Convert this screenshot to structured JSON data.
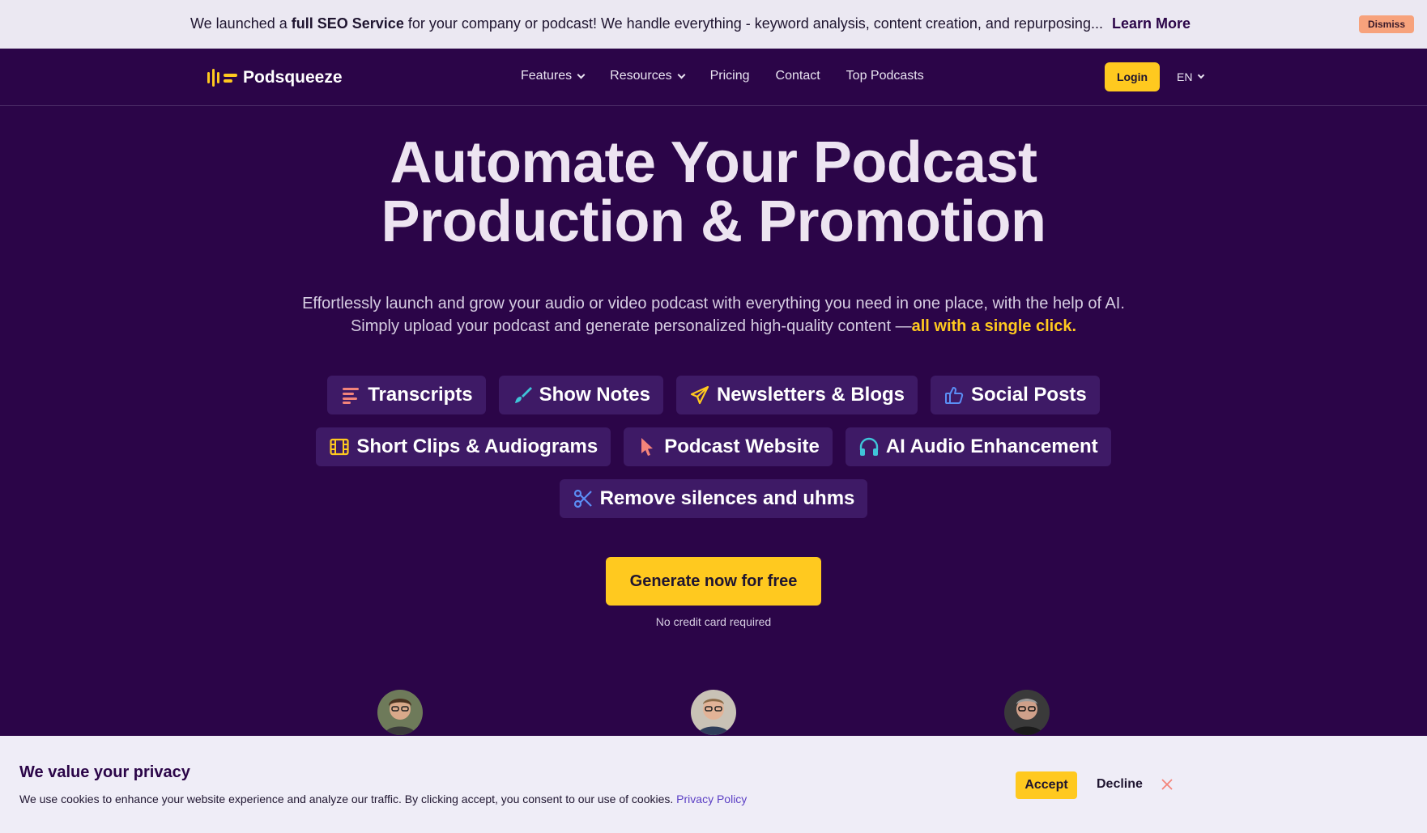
{
  "announcement": {
    "prefix": "We launched a ",
    "bold": "full SEO Service",
    "suffix": " for your company or podcast! We handle everything - keyword analysis, content creation, and repurposing...",
    "link": "Learn More",
    "dismiss": "Dismiss"
  },
  "nav": {
    "brand": "Podsqueeze",
    "items": [
      {
        "label": "Features"
      },
      {
        "label": "Resources"
      },
      {
        "label": "Pricing"
      },
      {
        "label": "Contact"
      },
      {
        "label": "Top Podcasts"
      }
    ],
    "login": "Login",
    "language": "EN"
  },
  "hero": {
    "title_line1": "Automate Your Podcast",
    "title_line2": "Production & Promotion",
    "sub_line1": "Effortlessly launch and grow your audio or video podcast with everything you need in one place, with the help of AI.",
    "sub_line2": "Simply upload your podcast and generate personalized high-quality content —",
    "sub_highlight": "all with a single click.",
    "features": [
      {
        "label": "Transcripts",
        "icon": "lines-icon"
      },
      {
        "label": "Show Notes",
        "icon": "brush-icon"
      },
      {
        "label": "Newsletters & Blogs",
        "icon": "paper-plane-icon"
      },
      {
        "label": "Social Posts",
        "icon": "thumbs-up-icon"
      },
      {
        "label": "Short Clips & Audiograms",
        "icon": "film-icon"
      },
      {
        "label": "Podcast Website",
        "icon": "cursor-icon"
      },
      {
        "label": "AI Audio Enhancement",
        "icon": "headphones-icon"
      },
      {
        "label": "Remove silences and uhms",
        "icon": "scissors-icon"
      }
    ],
    "cta": "Generate now for free",
    "cta_note": "No credit card required"
  },
  "cookie": {
    "title": "We value your privacy",
    "text": "We use cookies to enhance your website experience and analyze our traffic. By clicking accept, you consent to our use of cookies. ",
    "policy_link": "Privacy Policy",
    "accept": "Accept",
    "decline": "Decline"
  },
  "colors": {
    "background": "#2b0548",
    "accent": "#ffc91f",
    "chip": "#3e1a66",
    "banner": "#ebe8f2"
  }
}
